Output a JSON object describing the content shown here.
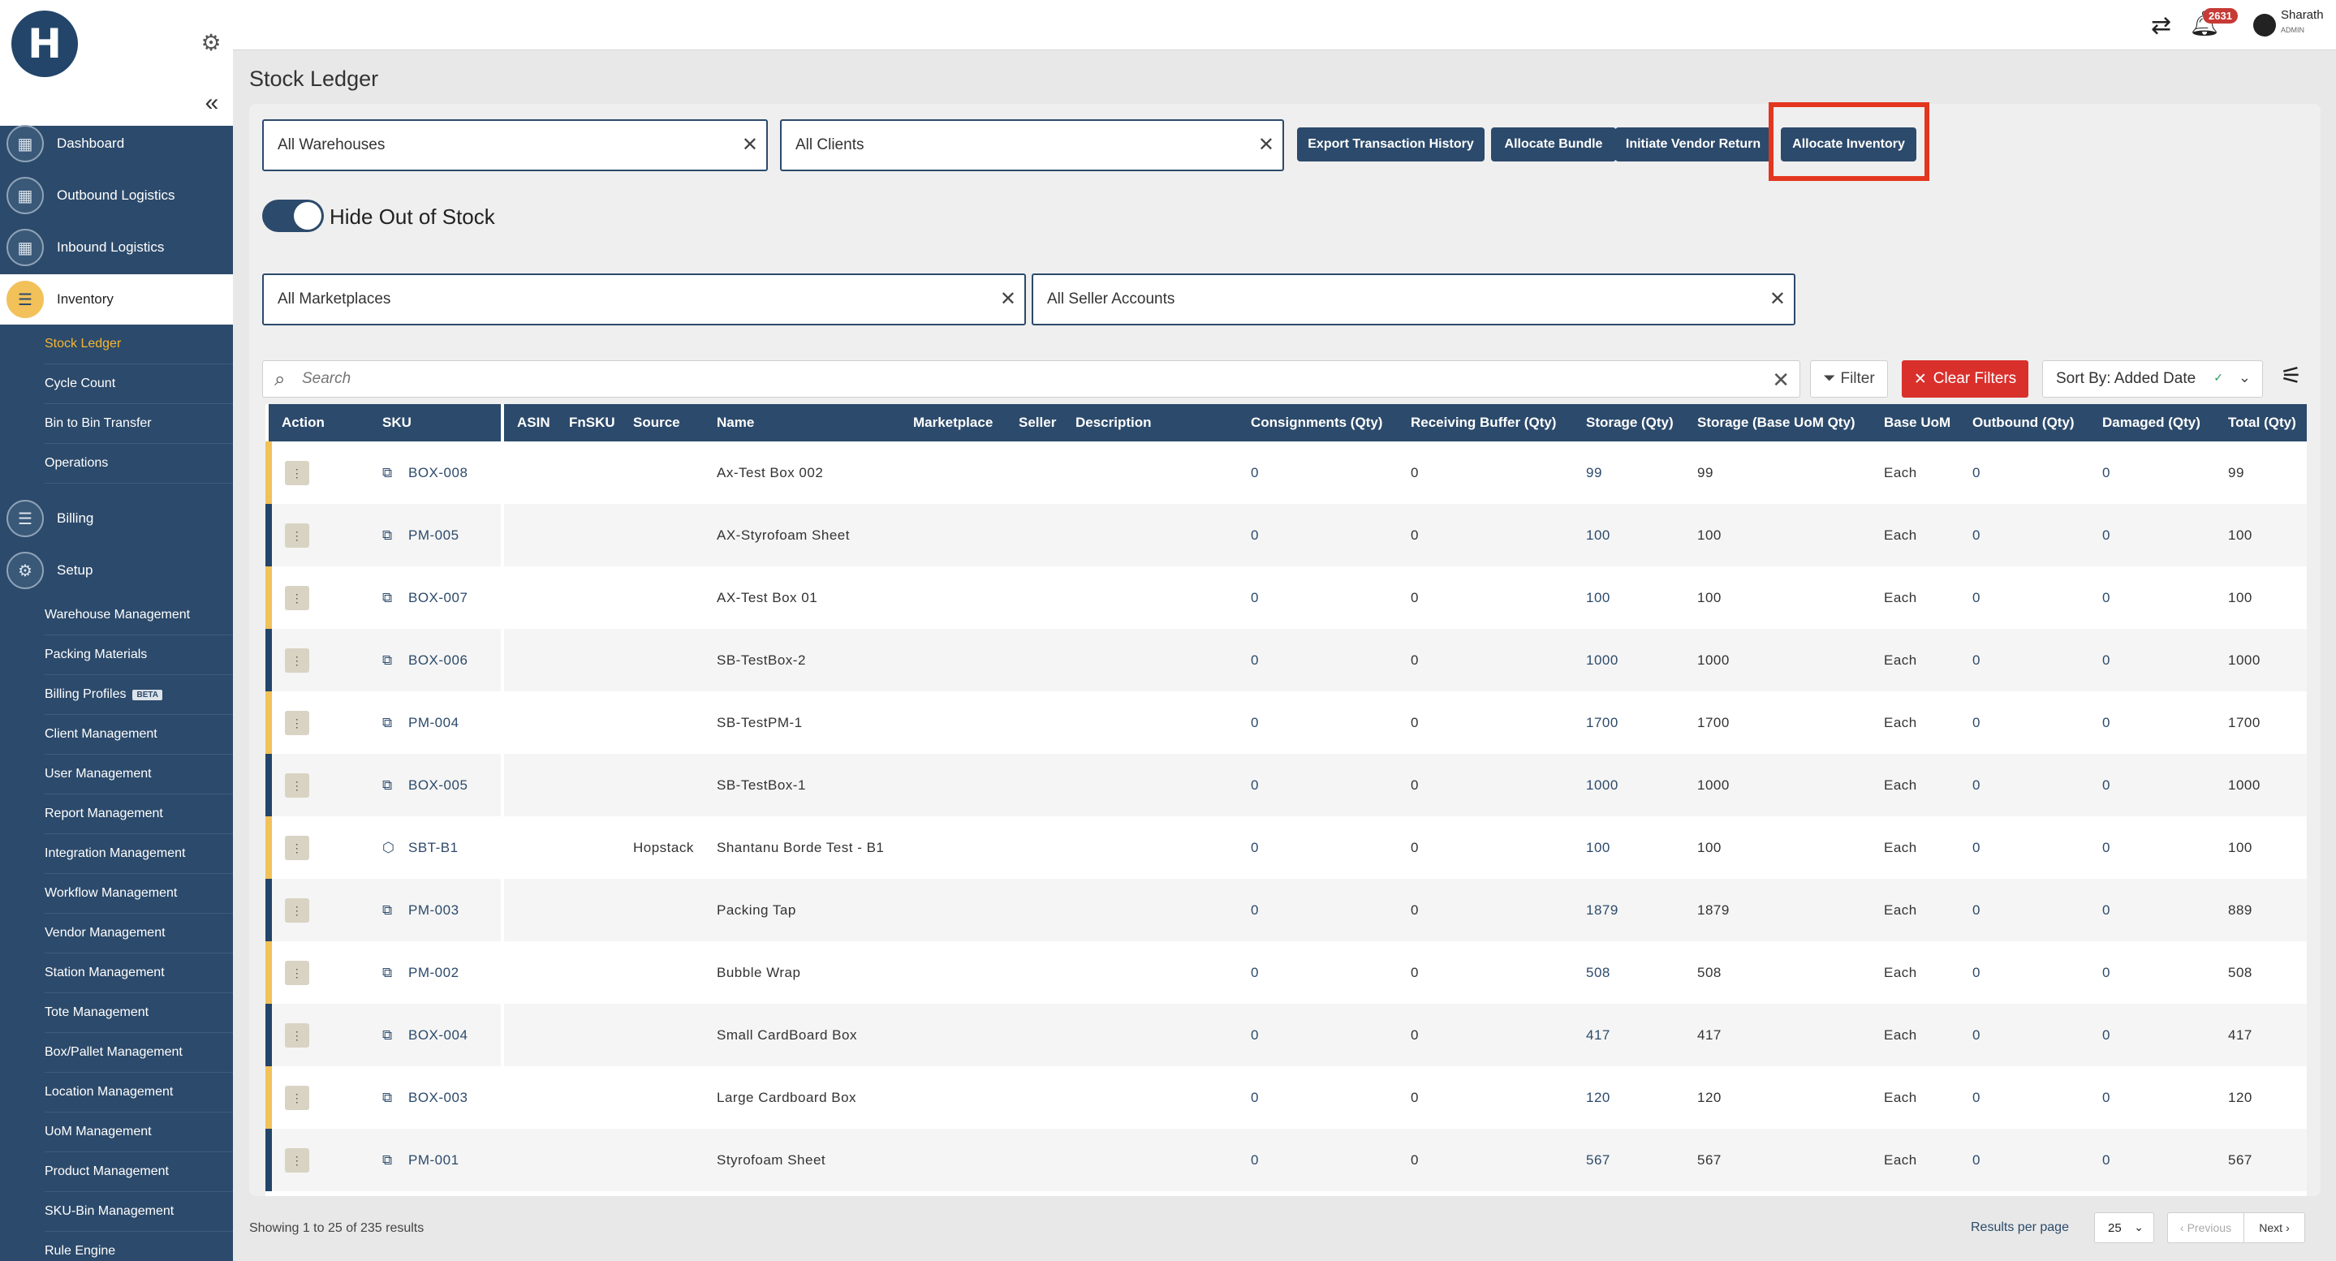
{
  "app": {
    "logo_text": "H"
  },
  "header": {
    "notif_count": "2631",
    "user_name": "Sharath",
    "user_role": "ADMIN"
  },
  "sidebar": {
    "items": [
      {
        "label": "Dashboard",
        "icon": "building-icon"
      },
      {
        "label": "Outbound Logistics",
        "icon": "building-icon"
      },
      {
        "label": "Inbound Logistics",
        "icon": "building-icon"
      },
      {
        "label": "Inventory",
        "icon": "list-icon"
      },
      {
        "label": "Billing",
        "icon": "list-icon"
      },
      {
        "label": "Setup",
        "icon": "cog-group-icon"
      }
    ],
    "inventory_sub": [
      "Stock Ledger",
      "Cycle Count",
      "Bin to Bin Transfer",
      "Operations"
    ],
    "setup_sub": [
      "Warehouse Management",
      "Packing Materials",
      "Billing Profiles",
      "Client Management",
      "User Management",
      "Report Management",
      "Integration Management",
      "Workflow Management",
      "Vendor Management",
      "Station Management",
      "Tote Management",
      "Box/Pallet Management",
      "Location Management",
      "UoM Management",
      "Product Management",
      "SKU-Bin Management",
      "Rule Engine"
    ],
    "beta_badge": "BETA"
  },
  "page": {
    "title": "Stock Ledger"
  },
  "filters": {
    "warehouse": "All Warehouses",
    "client": "All Clients",
    "marketplace": "All Marketplaces",
    "seller": "All Seller Accounts",
    "toggle_label": "Hide Out of Stock",
    "toggle_on": true
  },
  "actions": {
    "export": "Export Transaction History",
    "allocate_bundle": "Allocate Bundle",
    "vendor_return": "Initiate Vendor Return",
    "allocate_inventory": "Allocate Inventory"
  },
  "toolbar": {
    "search_placeholder": "Search",
    "filter_label": "Filter",
    "clear_label": "Clear Filters",
    "sort_label": "Sort By: Added Date"
  },
  "table": {
    "headers": [
      "Action",
      "SKU",
      "ASIN",
      "FnSKU",
      "Source",
      "Name",
      "Marketplace",
      "Seller",
      "Description",
      "Consignments (Qty)",
      "Receiving Buffer (Qty)",
      "Storage (Qty)",
      "Storage (Base UoM Qty)",
      "Base UoM",
      "Outbound (Qty)",
      "Damaged (Qty)",
      "Total (Qty)"
    ],
    "rows": [
      {
        "bar": "y",
        "sku": "BOX-008",
        "icon": "bundle",
        "asin": "",
        "fnsku": "",
        "source": "",
        "name": "Ax-Test Box 002",
        "marketplace": "",
        "seller": "",
        "description": "",
        "consignments": "0",
        "receiving": "0",
        "storage": "99",
        "storage_base": "99",
        "uom": "Each",
        "outbound": "0",
        "damaged": "0",
        "total": "99"
      },
      {
        "bar": "b",
        "sku": "PM-005",
        "icon": "bundle",
        "asin": "",
        "fnsku": "",
        "source": "",
        "name": "AX-Styrofoam Sheet",
        "marketplace": "",
        "seller": "",
        "description": "",
        "consignments": "0",
        "receiving": "0",
        "storage": "100",
        "storage_base": "100",
        "uom": "Each",
        "outbound": "0",
        "damaged": "0",
        "total": "100"
      },
      {
        "bar": "y",
        "sku": "BOX-007",
        "icon": "bundle",
        "asin": "",
        "fnsku": "",
        "source": "",
        "name": "AX-Test Box 01",
        "marketplace": "",
        "seller": "",
        "description": "",
        "consignments": "0",
        "receiving": "0",
        "storage": "100",
        "storage_base": "100",
        "uom": "Each",
        "outbound": "0",
        "damaged": "0",
        "total": "100"
      },
      {
        "bar": "b",
        "sku": "BOX-006",
        "icon": "bundle",
        "asin": "",
        "fnsku": "",
        "source": "",
        "name": "SB-TestBox-2",
        "marketplace": "",
        "seller": "",
        "description": "",
        "consignments": "0",
        "receiving": "0",
        "storage": "1000",
        "storage_base": "1000",
        "uom": "Each",
        "outbound": "0",
        "damaged": "0",
        "total": "1000"
      },
      {
        "bar": "y",
        "sku": "PM-004",
        "icon": "bundle",
        "asin": "",
        "fnsku": "",
        "source": "",
        "name": "SB-TestPM-1",
        "marketplace": "",
        "seller": "",
        "description": "",
        "consignments": "0",
        "receiving": "0",
        "storage": "1700",
        "storage_base": "1700",
        "uom": "Each",
        "outbound": "0",
        "damaged": "0",
        "total": "1700"
      },
      {
        "bar": "b",
        "sku": "BOX-005",
        "icon": "bundle",
        "asin": "",
        "fnsku": "",
        "source": "",
        "name": "SB-TestBox-1",
        "marketplace": "",
        "seller": "",
        "description": "",
        "consignments": "0",
        "receiving": "0",
        "storage": "1000",
        "storage_base": "1000",
        "uom": "Each",
        "outbound": "0",
        "damaged": "0",
        "total": "1000"
      },
      {
        "bar": "y",
        "sku": "SBT-B1",
        "icon": "cube",
        "asin": "",
        "fnsku": "",
        "source": "Hopstack",
        "name": "Shantanu Borde Test - B1",
        "marketplace": "",
        "seller": "",
        "description": "",
        "consignments": "0",
        "receiving": "0",
        "storage": "100",
        "storage_base": "100",
        "uom": "Each",
        "outbound": "0",
        "damaged": "0",
        "total": "100"
      },
      {
        "bar": "b",
        "sku": "PM-003",
        "icon": "bundle",
        "asin": "",
        "fnsku": "",
        "source": "",
        "name": "Packing Tap",
        "marketplace": "",
        "seller": "",
        "description": "",
        "consignments": "0",
        "receiving": "0",
        "storage": "1879",
        "storage_base": "1879",
        "uom": "Each",
        "outbound": "0",
        "damaged": "0",
        "total": "889"
      },
      {
        "bar": "y",
        "sku": "PM-002",
        "icon": "bundle",
        "asin": "",
        "fnsku": "",
        "source": "",
        "name": "Bubble Wrap",
        "marketplace": "",
        "seller": "",
        "description": "",
        "consignments": "0",
        "receiving": "0",
        "storage": "508",
        "storage_base": "508",
        "uom": "Each",
        "outbound": "0",
        "damaged": "0",
        "total": "508"
      },
      {
        "bar": "b",
        "sku": "BOX-004",
        "icon": "bundle",
        "asin": "",
        "fnsku": "",
        "source": "",
        "name": "Small CardBoard Box",
        "marketplace": "",
        "seller": "",
        "description": "",
        "consignments": "0",
        "receiving": "0",
        "storage": "417",
        "storage_base": "417",
        "uom": "Each",
        "outbound": "0",
        "damaged": "0",
        "total": "417"
      },
      {
        "bar": "y",
        "sku": "BOX-003",
        "icon": "bundle",
        "asin": "",
        "fnsku": "",
        "source": "",
        "name": "Large Cardboard Box",
        "marketplace": "",
        "seller": "",
        "description": "",
        "consignments": "0",
        "receiving": "0",
        "storage": "120",
        "storage_base": "120",
        "uom": "Each",
        "outbound": "0",
        "damaged": "0",
        "total": "120"
      },
      {
        "bar": "b",
        "sku": "PM-001",
        "icon": "bundle",
        "asin": "",
        "fnsku": "",
        "source": "",
        "name": "Styrofoam Sheet",
        "marketplace": "",
        "seller": "",
        "description": "",
        "consignments": "0",
        "receiving": "0",
        "storage": "567",
        "storage_base": "567",
        "uom": "Each",
        "outbound": "0",
        "damaged": "0",
        "total": "567"
      }
    ]
  },
  "footer": {
    "showing": "Showing 1 to 25 of 235 results",
    "rpp_label": "Results per page",
    "rpp_value": "25",
    "prev": "Previous",
    "next": "Next"
  },
  "colors": {
    "primary": "#2c4a6b",
    "accent": "#f2c15a",
    "danger": "#d9302c",
    "highlight": "#e3361e"
  }
}
